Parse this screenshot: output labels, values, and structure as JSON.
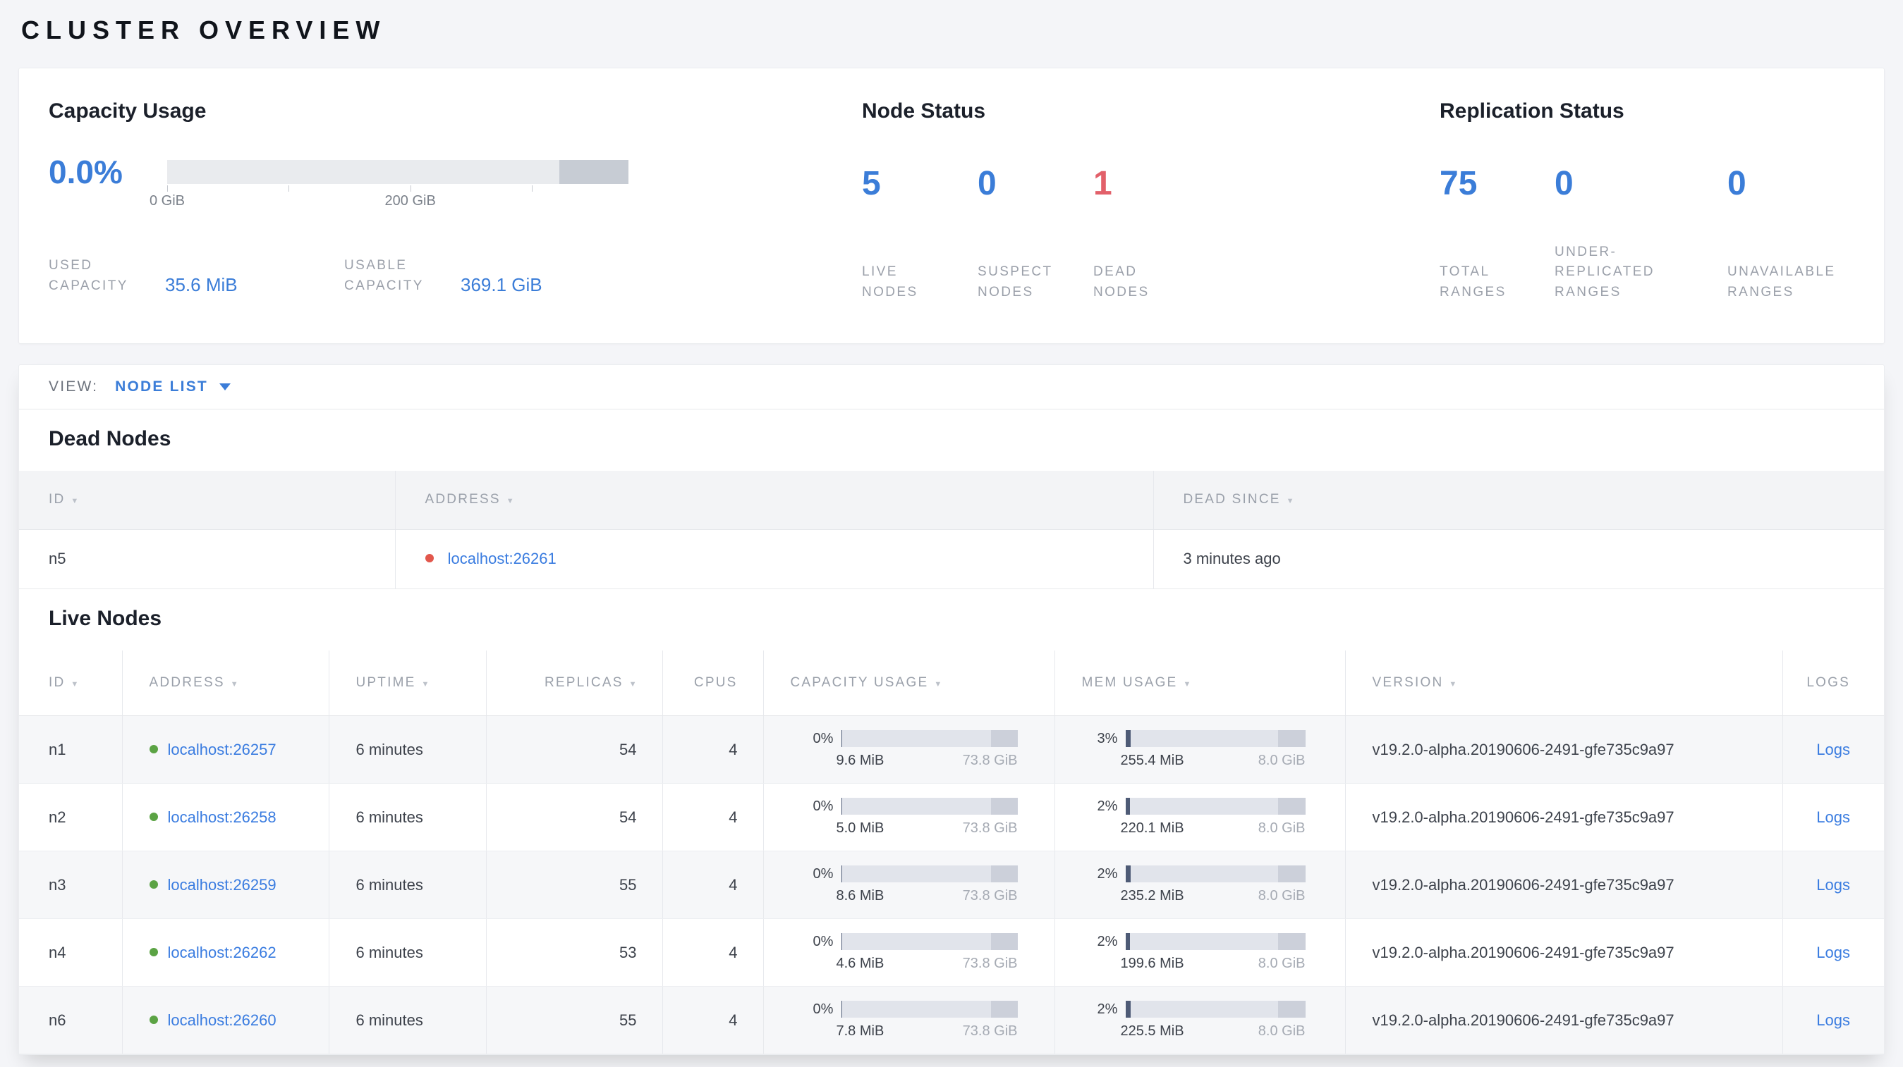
{
  "page_title": "CLUSTER OVERVIEW",
  "colors": {
    "accent_blue": "#3b7dd8",
    "danger_red": "#e2606a",
    "live_dot_green": "#5ba344",
    "dead_dot_red": "#e2574c"
  },
  "summary": {
    "capacity": {
      "title": "Capacity Usage",
      "percent": "0.0%",
      "bar_fraction": 0.0001,
      "axis_tick_0": "0 GiB",
      "axis_tick_200": "200 GiB",
      "used": {
        "label": "USED CAPACITY",
        "value": "35.6 MiB"
      },
      "usable": {
        "label": "USABLE CAPACITY",
        "value": "369.1 GiB"
      }
    },
    "node_status": {
      "title": "Node Status",
      "live": {
        "value": "5",
        "label": "LIVE NODES"
      },
      "suspect": {
        "value": "0",
        "label": "SUSPECT NODES"
      },
      "dead": {
        "value": "1",
        "label": "DEAD NODES"
      }
    },
    "replication": {
      "title": "Replication Status",
      "total": {
        "value": "75",
        "label": "TOTAL RANGES"
      },
      "under_replicated": {
        "value": "0",
        "label": "UNDER-REPLICATED RANGES"
      },
      "unavailable": {
        "value": "0",
        "label": "UNAVAILABLE RANGES"
      }
    }
  },
  "view_bar": {
    "label": "VIEW:",
    "selected": "NODE LIST"
  },
  "dead_nodes": {
    "title": "Dead Nodes",
    "columns": {
      "id": "ID",
      "address": "ADDRESS",
      "dead_since": "DEAD SINCE"
    },
    "rows": [
      {
        "id": "n5",
        "address": "localhost:26261",
        "dead_since": "3 minutes ago"
      }
    ]
  },
  "live_nodes": {
    "title": "Live Nodes",
    "columns": {
      "id": "ID",
      "address": "ADDRESS",
      "uptime": "UPTIME",
      "replicas": "REPLICAS",
      "cpus": "CPUS",
      "capacity": "CAPACITY USAGE",
      "mem": "MEM USAGE",
      "version": "VERSION",
      "logs": "LOGS"
    },
    "rows": [
      {
        "id": "n1",
        "address": "localhost:26257",
        "uptime": "6 minutes",
        "replicas": "54",
        "cpus": "4",
        "capacity": {
          "percent": "0%",
          "used": "9.6 MiB",
          "total": "73.8 GiB",
          "fraction": 0.001
        },
        "mem": {
          "percent": "3%",
          "used": "255.4 MiB",
          "total": "8.0 GiB",
          "fraction": 0.031
        },
        "version": "v19.2.0-alpha.20190606-2491-gfe735c9a97",
        "logs_label": "Logs"
      },
      {
        "id": "n2",
        "address": "localhost:26258",
        "uptime": "6 minutes",
        "replicas": "54",
        "cpus": "4",
        "capacity": {
          "percent": "0%",
          "used": "5.0 MiB",
          "total": "73.8 GiB",
          "fraction": 0.001
        },
        "mem": {
          "percent": "2%",
          "used": "220.1 MiB",
          "total": "8.0 GiB",
          "fraction": 0.027
        },
        "version": "v19.2.0-alpha.20190606-2491-gfe735c9a97",
        "logs_label": "Logs"
      },
      {
        "id": "n3",
        "address": "localhost:26259",
        "uptime": "6 minutes",
        "replicas": "55",
        "cpus": "4",
        "capacity": {
          "percent": "0%",
          "used": "8.6 MiB",
          "total": "73.8 GiB",
          "fraction": 0.001
        },
        "mem": {
          "percent": "2%",
          "used": "235.2 MiB",
          "total": "8.0 GiB",
          "fraction": 0.029
        },
        "version": "v19.2.0-alpha.20190606-2491-gfe735c9a97",
        "logs_label": "Logs"
      },
      {
        "id": "n4",
        "address": "localhost:26262",
        "uptime": "6 minutes",
        "replicas": "53",
        "cpus": "4",
        "capacity": {
          "percent": "0%",
          "used": "4.6 MiB",
          "total": "73.8 GiB",
          "fraction": 0.001
        },
        "mem": {
          "percent": "2%",
          "used": "199.6 MiB",
          "total": "8.0 GiB",
          "fraction": 0.024
        },
        "version": "v19.2.0-alpha.20190606-2491-gfe735c9a97",
        "logs_label": "Logs"
      },
      {
        "id": "n6",
        "address": "localhost:26260",
        "uptime": "6 minutes",
        "replicas": "55",
        "cpus": "4",
        "capacity": {
          "percent": "0%",
          "used": "7.8 MiB",
          "total": "73.8 GiB",
          "fraction": 0.001
        },
        "mem": {
          "percent": "2%",
          "used": "225.5 MiB",
          "total": "8.0 GiB",
          "fraction": 0.028
        },
        "version": "v19.2.0-alpha.20190606-2491-gfe735c9a97",
        "logs_label": "Logs"
      }
    ]
  }
}
